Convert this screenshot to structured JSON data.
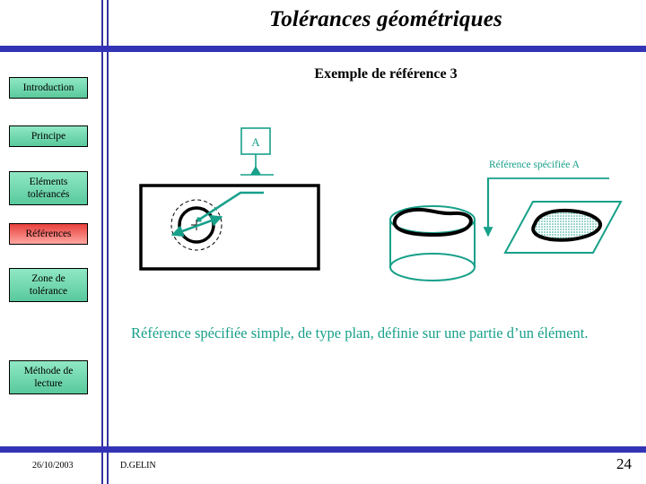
{
  "slide": {
    "title": "Tolérances géométriques",
    "subtitle": "Exemple de référence 3",
    "caption": "Référence spécifiée simple, de type plan, définie sur une partie d’un élément."
  },
  "sidebar": {
    "items": [
      {
        "label": "Introduction",
        "state": "normal"
      },
      {
        "label": "Principe",
        "state": "normal"
      },
      {
        "label": "Eléments tolérancés",
        "state": "normal"
      },
      {
        "label": "Références",
        "state": "active"
      },
      {
        "label": "Zone de tolérance",
        "state": "normal"
      },
      {
        "label": "Méthode de lecture",
        "state": "normal"
      }
    ]
  },
  "drawing": {
    "datum_box_label": "A",
    "reference_label": "Référence spécifiée A"
  },
  "footer": {
    "date": "26/10/2003",
    "author": "D.GELIN",
    "page": "24"
  },
  "colors": {
    "rule_blue": "#3333b5",
    "nav_green_top": "#8fe8c4",
    "nav_green_bottom": "#59c99c",
    "nav_red_top": "#e8403c",
    "nav_red_bottom": "#ffa7a2",
    "teal": "#17a08a",
    "ink": "#000000"
  }
}
